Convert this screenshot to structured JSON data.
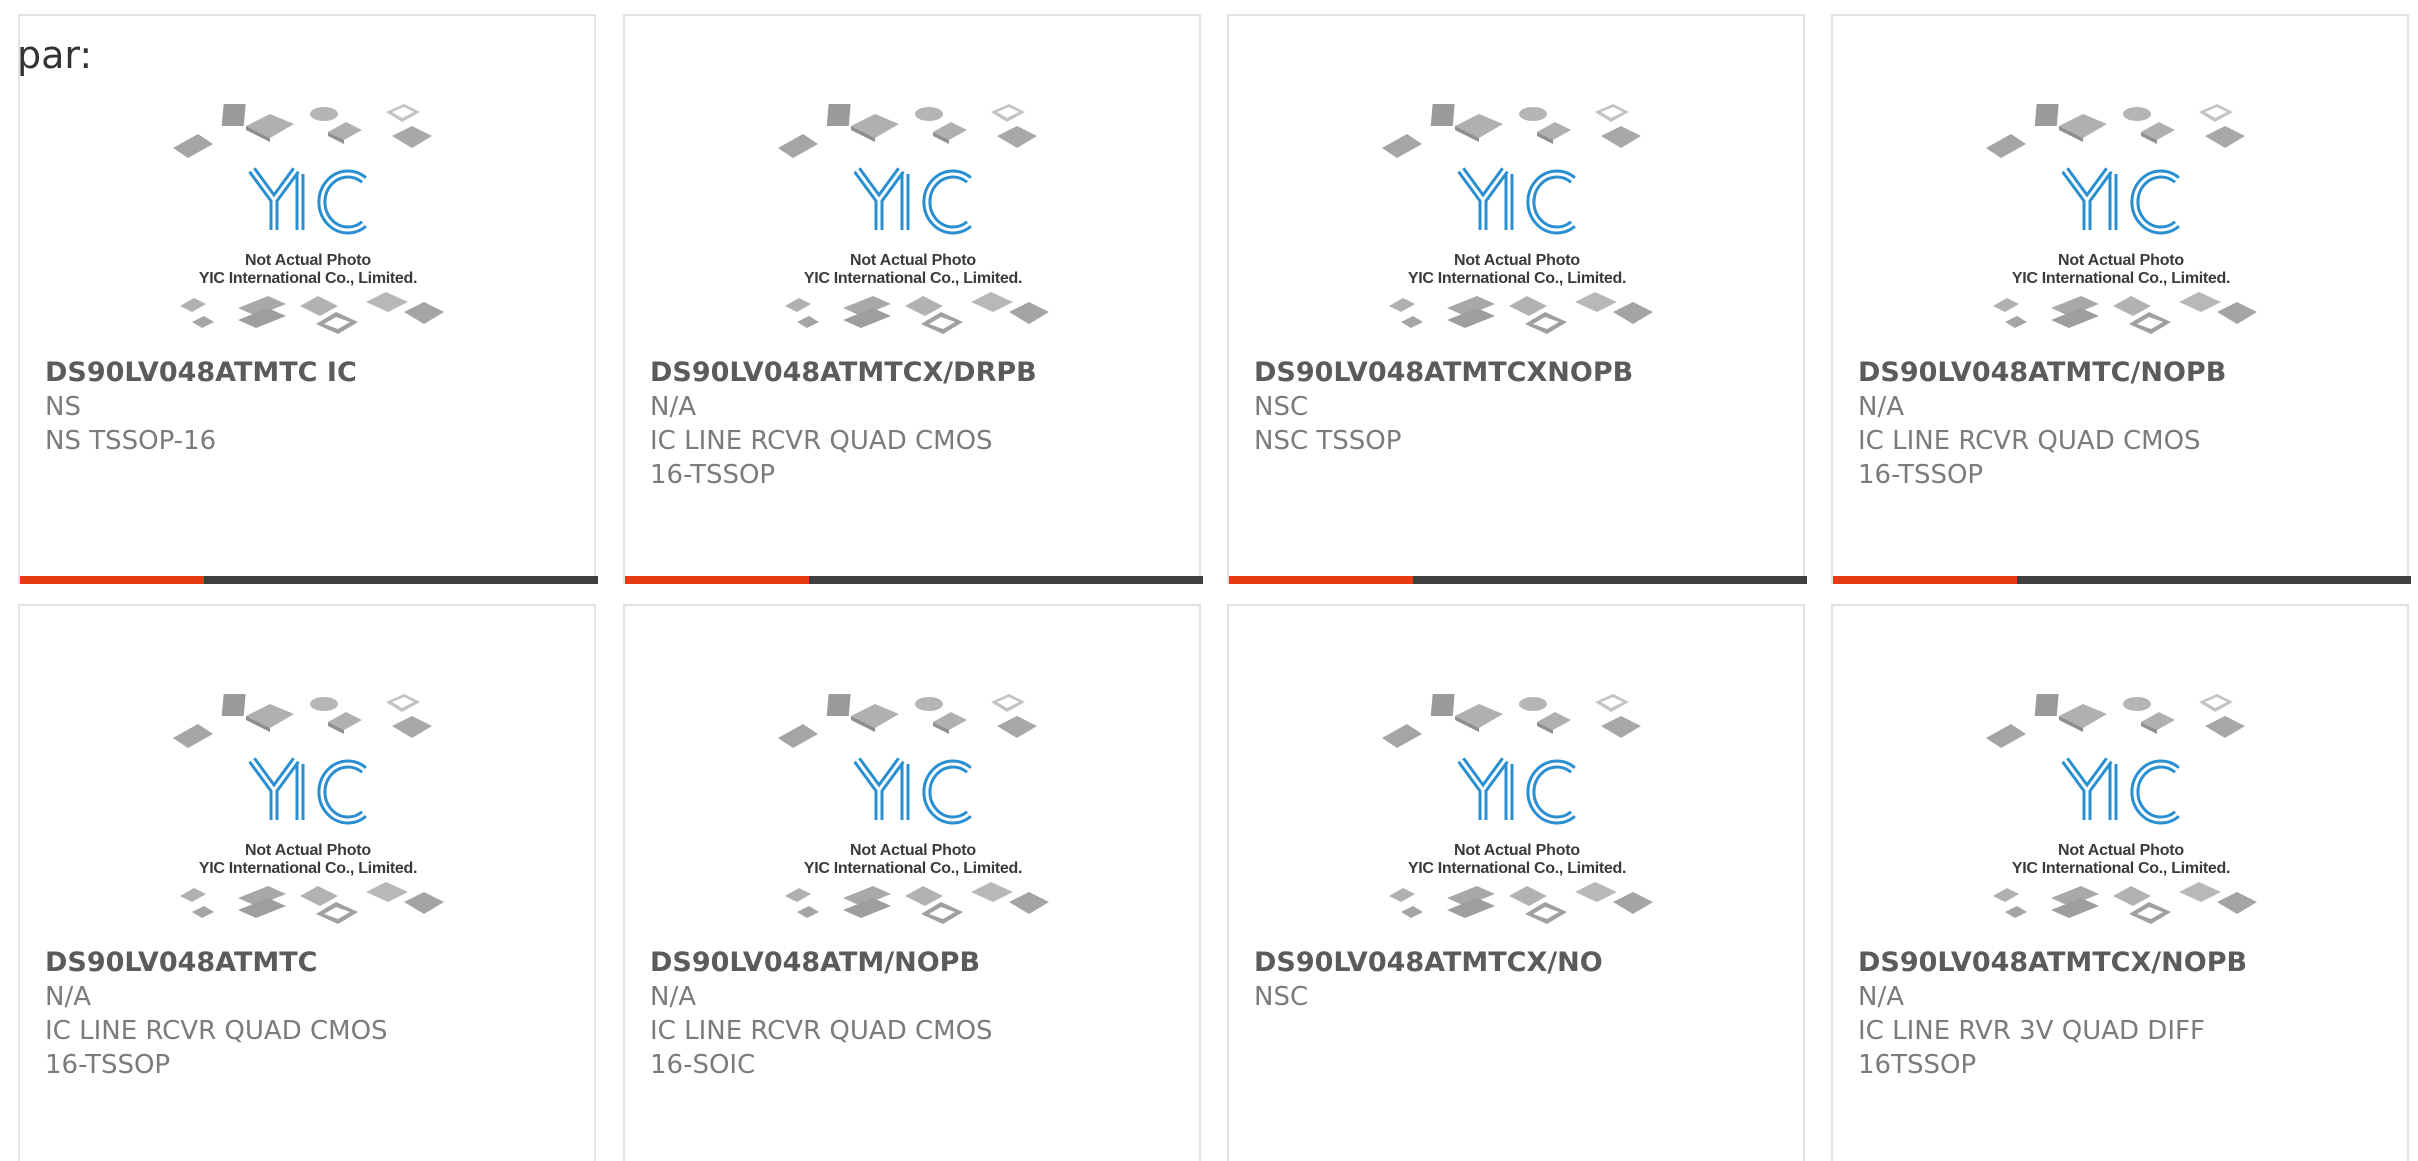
{
  "heading": "par:",
  "placeholder_image": {
    "line1": "Not Actual Photo",
    "line2": "YIC International Co., Limited.",
    "logo": "YIC"
  },
  "colors": {
    "accent": "#e53a12",
    "bar_dark": "#3f3f3f",
    "logo_blue": "#2a8fd0",
    "text_gray": "#7b7b7b"
  },
  "products": [
    {
      "part": "DS90LV048ATMTC IC",
      "manufacturer": "NS",
      "description": "NS TSSOP-16"
    },
    {
      "part": "DS90LV048ATMTCX/DRPB",
      "manufacturer": "N/A",
      "description": "IC LINE RCVR QUAD CMOS 16-TSSOP"
    },
    {
      "part": "DS90LV048ATMTCXNOPB",
      "manufacturer": "NSC",
      "description": "NSC TSSOP"
    },
    {
      "part": "DS90LV048ATMTC/NOPB",
      "manufacturer": "N/A",
      "description": "IC LINE RCVR QUAD CMOS 16-TSSOP"
    },
    {
      "part": "DS90LV048ATMTC",
      "manufacturer": "N/A",
      "description": "IC LINE RCVR QUAD CMOS 16-TSSOP"
    },
    {
      "part": "DS90LV048ATM/NOPB",
      "manufacturer": "N/A",
      "description": "IC LINE RCVR QUAD CMOS 16-SOIC"
    },
    {
      "part": "DS90LV048ATMTCX/NO",
      "manufacturer": "NSC",
      "description": ""
    },
    {
      "part": "DS90LV048ATMTCX/NOPB",
      "manufacturer": "N/A",
      "description": "IC LINE RVR 3V QUAD DIFF 16TSSOP"
    }
  ]
}
